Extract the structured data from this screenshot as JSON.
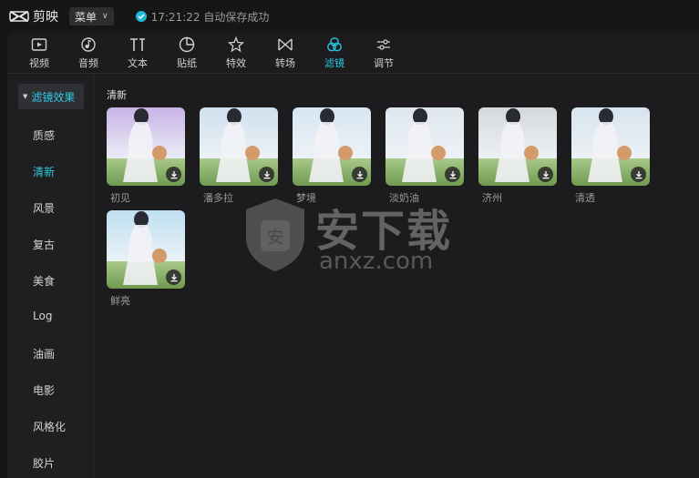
{
  "app": {
    "name": "剪映"
  },
  "titlebar": {
    "menu_label": "菜单",
    "save_status": "17:21:22 自动保存成功"
  },
  "toolbar": {
    "tabs": [
      {
        "label": "视频",
        "icon": "video-icon"
      },
      {
        "label": "音频",
        "icon": "audio-icon"
      },
      {
        "label": "文本",
        "icon": "text-icon"
      },
      {
        "label": "贴纸",
        "icon": "sticker-icon"
      },
      {
        "label": "特效",
        "icon": "effects-icon"
      },
      {
        "label": "转场",
        "icon": "transition-icon"
      },
      {
        "label": "滤镜",
        "icon": "filter-icon",
        "active": true
      },
      {
        "label": "调节",
        "icon": "adjust-icon"
      }
    ]
  },
  "sidebar": {
    "section_label": "滤镜效果",
    "items": [
      {
        "label": "质感"
      },
      {
        "label": "清新",
        "active": true
      },
      {
        "label": "风景"
      },
      {
        "label": "复古"
      },
      {
        "label": "美食"
      },
      {
        "label": "Log"
      },
      {
        "label": "油画"
      },
      {
        "label": "电影"
      },
      {
        "label": "风格化"
      },
      {
        "label": "胶片"
      }
    ]
  },
  "content": {
    "section_title": "清新",
    "filters": [
      {
        "name": "初见",
        "tint": "#c9b3e6"
      },
      {
        "name": "潘多拉",
        "tint": "#cfe0ee"
      },
      {
        "name": "梦境",
        "tint": "#d8e6f2"
      },
      {
        "name": "淡奶油",
        "tint": "#dfe7ee"
      },
      {
        "name": "济州",
        "tint": "#d6d9dc"
      },
      {
        "name": "清透",
        "tint": "#d7e4ee"
      },
      {
        "name": "鲜亮",
        "tint": "#bfe0f2"
      }
    ]
  },
  "watermark": {
    "text": "安下载",
    "sub": "anxz.com"
  },
  "colors": {
    "accent": "#26c6e0",
    "background": "#161616",
    "panel": "#1c1c1e"
  }
}
